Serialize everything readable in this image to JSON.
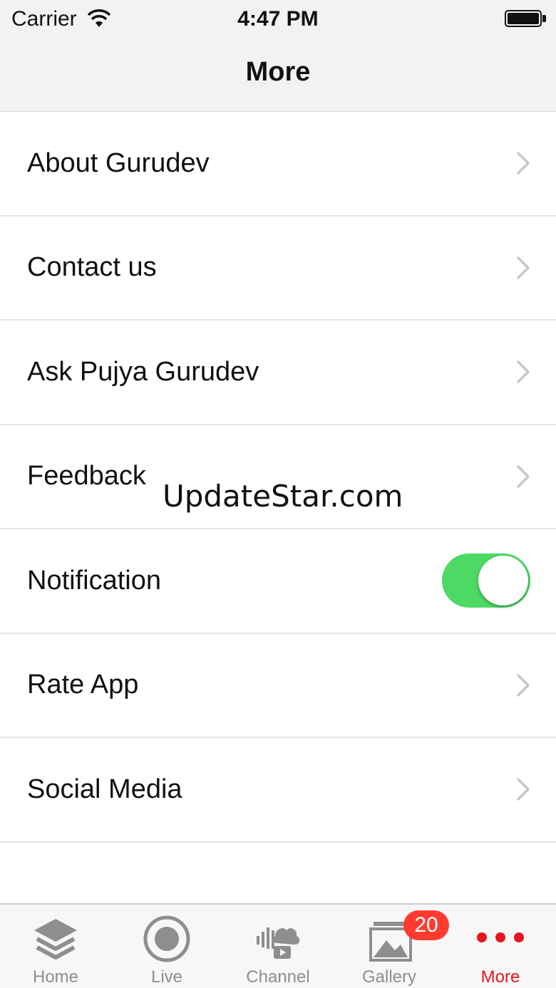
{
  "status_bar": {
    "carrier": "Carrier",
    "time": "4:47 PM"
  },
  "nav": {
    "title": "More"
  },
  "menu": {
    "items": [
      {
        "label": "About Gurudev",
        "accessory": "chevron-right-icon"
      },
      {
        "label": "Contact us",
        "accessory": "chevron-right-icon"
      },
      {
        "label": "Ask Pujya Gurudev",
        "accessory": "chevron-right-icon"
      },
      {
        "label": "Feedback",
        "accessory": "chevron-right-icon"
      },
      {
        "label": "Notification",
        "accessory": "toggle",
        "toggle_on": true
      },
      {
        "label": "Rate App",
        "accessory": "chevron-right-icon"
      },
      {
        "label": "Social Media",
        "accessory": "chevron-right-icon"
      }
    ]
  },
  "watermark": "UpdateStar.com",
  "tabbar": {
    "tabs": [
      {
        "label": "Home",
        "icon": "layers-icon",
        "active": false
      },
      {
        "label": "Live",
        "icon": "record-icon",
        "active": false
      },
      {
        "label": "Channel",
        "icon": "channel-icon",
        "active": false
      },
      {
        "label": "Gallery",
        "icon": "gallery-icon",
        "active": false,
        "badge": "20"
      },
      {
        "label": "More",
        "icon": "more-dots-icon",
        "active": true
      }
    ]
  },
  "colors": {
    "toggle_on": "#4cd964",
    "active_tab": "#e8141f",
    "inactive_tab": "#8e8e8e",
    "badge": "#ff3b30",
    "navbar_bg": "#f2f2f2"
  }
}
